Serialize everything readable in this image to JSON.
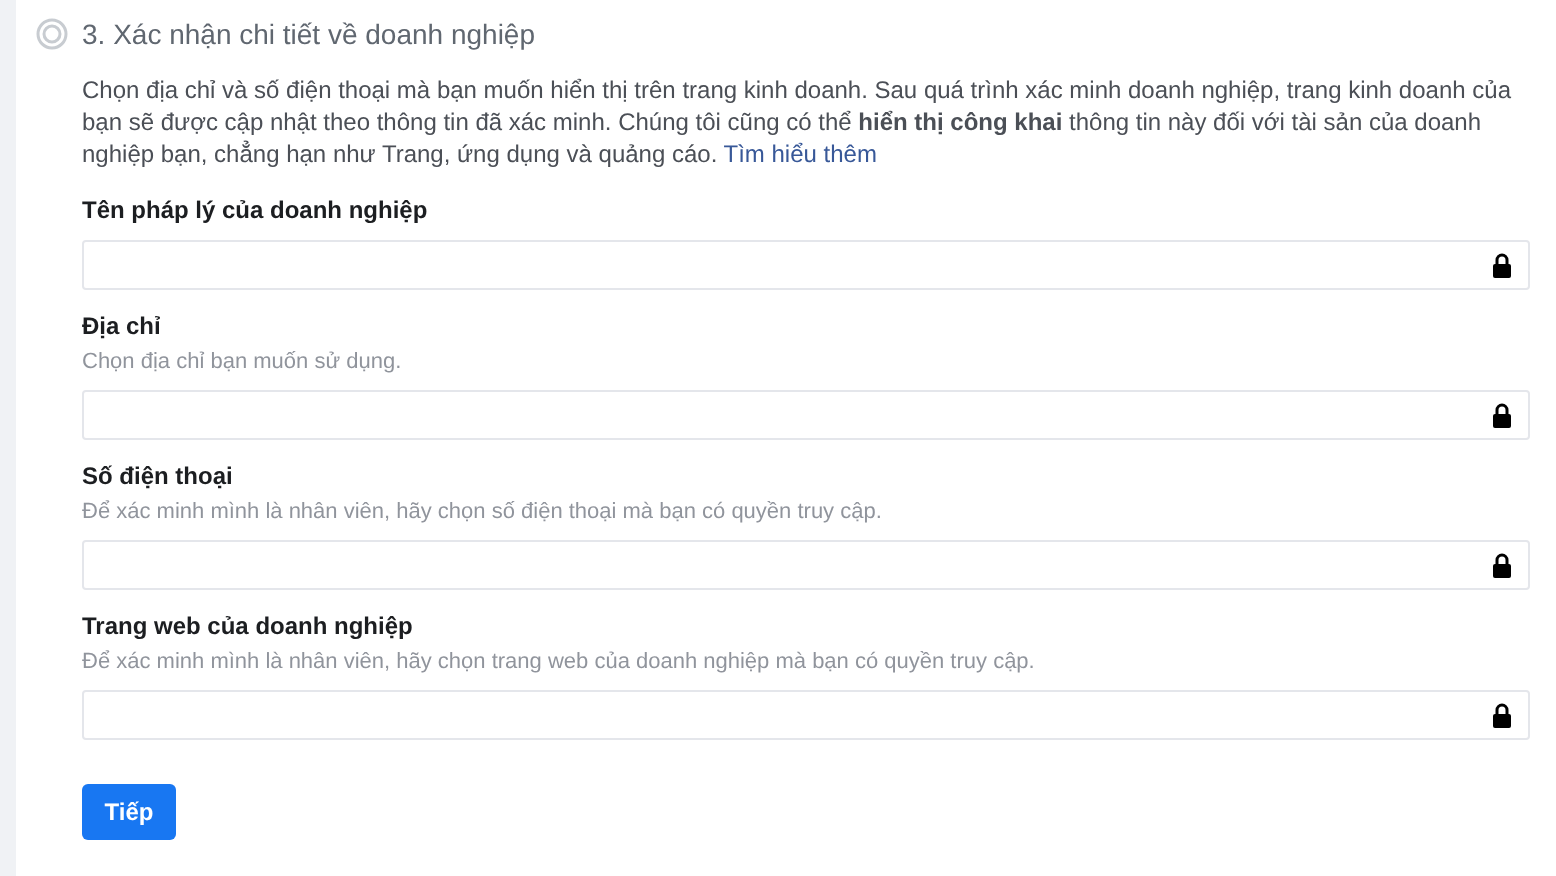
{
  "step": {
    "title": "3. Xác nhận chi tiết về doanh nghiệp"
  },
  "intro": {
    "text": "Chọn địa chỉ và số điện thoại mà bạn muốn hiển thị trên trang kinh doanh. Sau quá trình xác minh doanh nghiệp, trang kinh doanh của bạn sẽ được cập nhật theo thông tin đã xác minh. Chúng tôi cũng có thể **hiển thị công khai** thông tin này đối với tài sản của doanh nghiệp bạn, chẳng hạn như Trang, ứng dụng và quảng cáo.",
    "link": "Tìm hiểu thêm"
  },
  "fields": [
    {
      "label": "Tên pháp lý của doanh nghiệp"
    },
    {
      "label": "Địa chỉ",
      "hint": "Chọn địa chỉ bạn muốn sử dụng."
    },
    {
      "label": "Số điện thoại",
      "hint": "Để xác minh mình là nhân viên, hãy chọn số điện thoại mà bạn có quyền truy cập."
    },
    {
      "label": "Trang web của doanh nghiệp",
      "hint": "Để xác minh mình là nhân viên, hãy chọn trang web của doanh nghiệp mà bạn có quyền truy cập."
    }
  ],
  "next_button": "Tiếp"
}
